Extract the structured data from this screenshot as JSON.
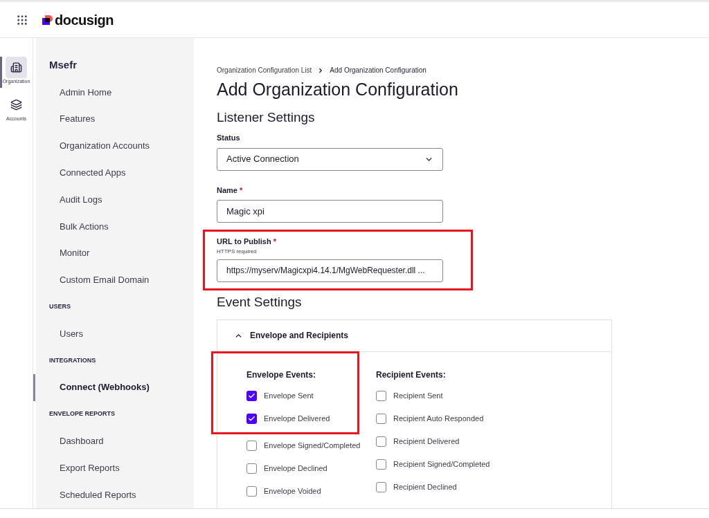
{
  "header": {
    "logo": "docusign"
  },
  "rail": [
    {
      "label": "Organization",
      "kind": "organization",
      "selected": true
    },
    {
      "label": "Accounts",
      "kind": "accounts",
      "selected": false
    }
  ],
  "sidebar": {
    "title": "Msefr",
    "items": [
      {
        "kind": "link",
        "label": "Admin Home",
        "selected": false
      },
      {
        "kind": "link",
        "label": "Features",
        "selected": false
      },
      {
        "kind": "link",
        "label": "Organization Accounts",
        "selected": false
      },
      {
        "kind": "link",
        "label": "Connected Apps",
        "selected": false
      },
      {
        "kind": "link",
        "label": "Audit Logs",
        "selected": false
      },
      {
        "kind": "link",
        "label": "Bulk Actions",
        "selected": false
      },
      {
        "kind": "link",
        "label": "Monitor",
        "selected": false
      },
      {
        "kind": "link",
        "label": "Custom Email Domain",
        "selected": false
      },
      {
        "kind": "heading",
        "label": "USERS"
      },
      {
        "kind": "link",
        "label": "Users",
        "selected": false
      },
      {
        "kind": "heading",
        "label": "INTEGRATIONS"
      },
      {
        "kind": "link",
        "label": "Connect (Webhooks)",
        "selected": true
      },
      {
        "kind": "heading",
        "label": "ENVELOPE REPORTS"
      },
      {
        "kind": "link",
        "label": "Dashboard",
        "selected": false
      },
      {
        "kind": "link",
        "label": "Export Reports",
        "selected": false
      },
      {
        "kind": "link",
        "label": "Scheduled Reports",
        "selected": false
      }
    ]
  },
  "breadcrumb": [
    "Organization Configuration List",
    "Add Organization Configuration"
  ],
  "title": "Add Organization Configuration",
  "listener": {
    "heading": "Listener Settings",
    "status": {
      "label": "Status",
      "value": "Active Connection"
    },
    "name": {
      "label": "Name",
      "required_mark": "*",
      "value": "Magic xpi"
    },
    "url": {
      "label": "URL to Publish",
      "required_mark": "*",
      "hint": "HTTPS required",
      "value": "https://myserv/Magicxpi4.14.1/MgWebRequester.dll ..."
    }
  },
  "events": {
    "heading": "Event Settings",
    "section": {
      "title": "Envelope and Recipients",
      "expanded": true,
      "columns": [
        {
          "heading": "Envelope Events:",
          "items": [
            {
              "label": "Envelope Sent",
              "checked": true
            },
            {
              "label": "Envelope Delivered",
              "checked": true
            },
            {
              "label": "Envelope Signed/Completed",
              "checked": false
            },
            {
              "label": "Envelope Declined",
              "checked": false
            },
            {
              "label": "Envelope Voided",
              "checked": false
            }
          ]
        },
        {
          "heading": "Recipient Events:",
          "items": [
            {
              "label": "Recipient Sent",
              "checked": false
            },
            {
              "label": "Recipient Auto Responded",
              "checked": false
            },
            {
              "label": "Recipient Delivered",
              "checked": false
            },
            {
              "label": "Recipient Signed/Completed",
              "checked": false
            },
            {
              "label": "Recipient Declined",
              "checked": false
            }
          ]
        }
      ]
    }
  }
}
